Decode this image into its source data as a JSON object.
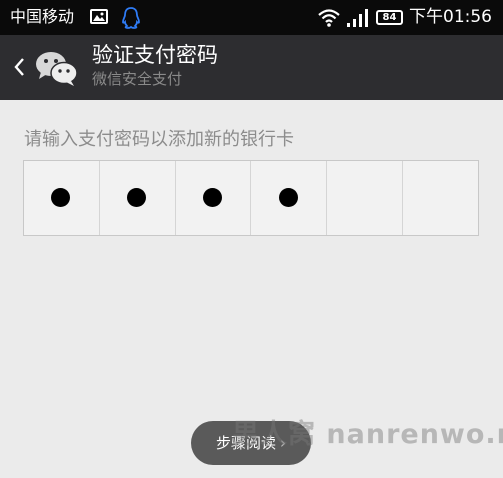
{
  "status_bar": {
    "carrier": "中国移动",
    "battery": "84",
    "time": "下午01:56",
    "icons": [
      "image-icon",
      "qq-icon",
      "wifi-icon",
      "signal-icon",
      "battery-icon"
    ]
  },
  "header": {
    "title": "验证支付密码",
    "subtitle": "微信安全支付",
    "icons": [
      "back-icon",
      "wechat-icon"
    ]
  },
  "main": {
    "prompt": "请输入支付密码以添加新的银行卡",
    "pin": {
      "length": 6,
      "filled": 4,
      "cells": [
        "●",
        "●",
        "●",
        "●",
        "",
        ""
      ]
    }
  },
  "toast": {
    "label": "步骤阅读",
    "chevron": "›"
  },
  "watermark": {
    "text": "男人窝 nanrenwo.net"
  },
  "colors": {
    "status_bar_bg": "#0a0a0a",
    "header_bg": "#2d2d30",
    "page_bg": "#ebebeb",
    "dot": "#000000"
  }
}
